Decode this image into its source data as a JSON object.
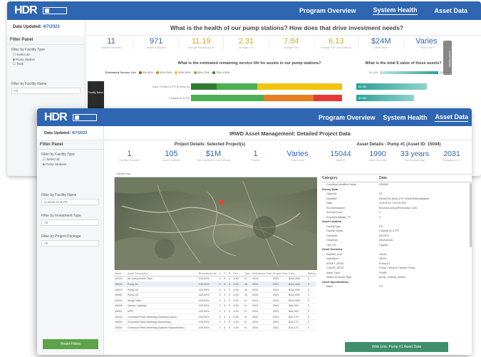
{
  "back": {
    "nav": {
      "program": "Program Overview",
      "health": "System Health",
      "assets": "Asset Data"
    },
    "data_updated_label": "Data Updated:",
    "data_updated_value": "4/7/2023",
    "question": "What is the health of our pump stations? How does that drive investment needs?",
    "filter_panel": {
      "title": "Filter Panel",
      "facility_type_label": "Filter by Facility Type",
      "options": [
        "Select all",
        "Pump Station",
        "Tank"
      ],
      "facility_name_label": "Filter by Facility Name",
      "facility_name_value": "All"
    },
    "kpis": [
      {
        "value": "11",
        "label": "Facilities Reported",
        "color": "#2f66b1"
      },
      {
        "value": "971",
        "label": "Assets Evaluated",
        "color": "#2f66b1"
      },
      {
        "value": "11.19",
        "label": "Average Remaining Life",
        "color": "#e6a21a"
      },
      {
        "value": "2.31",
        "label": "Average CoF",
        "color": "#c9b21c"
      },
      {
        "value": "7.84",
        "label": "Average Risk",
        "color": "#c9b21c"
      },
      {
        "value": "6.13",
        "label": "Average PoF (Yrs to failure)",
        "color": "#c9b21c"
      },
      {
        "value": "$24M",
        "label": "Asset Value",
        "color": "#2f66b1"
      },
      {
        "value": "Varies",
        "label": "Install Year",
        "color": "#2f66b1"
      }
    ],
    "chart_q1": "What is the estimated remaining service life for assets in our pump stations?",
    "chart_q2": "What is the total $ value of these assets?",
    "legend_title": "Estimated Service Life",
    "legend": [
      {
        "label": "0%-10%",
        "color": "#c0392b"
      },
      {
        "label": "10%-25%",
        "color": "#e67e22"
      },
      {
        "label": "25%-50%",
        "color": "#f1c40f"
      },
      {
        "label": "50%-75%",
        "color": "#7cb342"
      },
      {
        "label": "75%-100%",
        "color": "#2e7d32"
      }
    ],
    "value_legend": {
      "min": "$1,429",
      "max": "$1,941"
    },
    "side_tab": "Asset Details",
    "rows": [
      {
        "name": "Lake Forest Dr PS (Forest N)",
        "val": "$2.9M",
        "segs": [
          0.17,
          0.27,
          0.56,
          0,
          0
        ],
        "fill": 0.72
      },
      {
        "name": "Coastal Dr & PS",
        "val": "$2.8M",
        "segs": [
          0,
          0.48,
          0,
          0.33,
          0.19
        ],
        "fill": 0.55
      }
    ],
    "facility_label": "Facility Name"
  },
  "front": {
    "nav": {
      "program": "Program Overview",
      "health": "System Health",
      "assets": "Asset Data"
    },
    "data_updated_label": "Data Updated:",
    "data_updated_value": "4/7/2023",
    "title": "IRWD Asset Management: Detailed Project Data",
    "filter_panel": {
      "title": "Filter Panel",
      "facility_type_label": "Filter by Facility Type",
      "options": [
        "Select all",
        "Pump Stations"
      ],
      "facility_name_label": "Filter by Facility Name",
      "facility_name_value": "Coastal Dr & PS",
      "investment_label": "Filter by Investment Type",
      "investment_value": "All",
      "package_label": "Filter by Project Package",
      "package_value": "All",
      "reset": "Reset Filters"
    },
    "project_header": "Project Details: Selected Project(s)",
    "project_kpis": [
      {
        "value": "1",
        "label": "Facilities Selected"
      },
      {
        "value": "105",
        "label": "Assets Selected"
      },
      {
        "value": "$1M",
        "label": "Total Investment Cost Estimate"
      },
      {
        "value": "1",
        "label": "Projects"
      },
      {
        "value": "Varies",
        "label": "Project Year"
      }
    ],
    "map_label": "Satellite Map",
    "asset_header": "Asset Details - Pump #1 (Asset ID: 15044)",
    "asset_kpis": [
      {
        "value": "15044",
        "label": "Asset ID"
      },
      {
        "value": "1990",
        "label": "Install Year (est)"
      },
      {
        "value": "33 years",
        "label": "Current Asset Age"
      },
      {
        "value": "2031",
        "label": "Replacement Yr"
      }
    ],
    "table_headers": [
      "Asset",
      "Asset Description",
      "Remaining Life",
      "C",
      "P",
      "R",
      "EUL",
      "Type",
      "Investment Year",
      "Project Year",
      "Cost",
      "Rating"
    ],
    "table_rows": [
      [
        "15104",
        "Air Compressor Tank",
        "100.00%",
        "2",
        "3",
        "3",
        "3.00",
        "N",
        "2031",
        "2031",
        "$112,006",
        "3"
      ],
      [
        "15044",
        "Pump #1",
        "100.00%",
        "2",
        "3",
        "3",
        "3.00",
        "10",
        "2031",
        "2031",
        "$112,006",
        "3"
      ],
      [
        "15002",
        "Pump #2",
        "100.00%",
        "2",
        "3",
        "3",
        "3.00",
        "10",
        "2031",
        "2031",
        "$112,006",
        "3"
      ],
      [
        "15060",
        "Pump #3",
        "100.00%",
        "2",
        "3",
        "3",
        "3.00",
        "10",
        "2031",
        "2031",
        "$112,006",
        "3"
      ],
      [
        "15010",
        "Surge Tank",
        "100.00%",
        "2",
        "3",
        "3",
        "3.00",
        "N",
        "2031",
        "2031",
        "$112,006",
        "3"
      ],
      [
        "15006",
        "Interior Lighting",
        "100.00%",
        "2",
        "3",
        "3",
        "3.00",
        "N",
        "2031",
        "2031",
        "$46,000",
        "3"
      ],
      [
        "15041",
        "UPS",
        "100.00%",
        "2",
        "3",
        "3",
        "3.00",
        "N",
        "2031",
        "2031",
        "$46,000",
        "3"
      ],
      [
        "15014",
        "Chemical Feed Metering (Sodium/Liquid)",
        "100.00%",
        "2",
        "3",
        "3",
        "3.00",
        "N",
        "2031",
        "2031",
        "$14,170",
        "3"
      ],
      [
        "15024",
        "Chemical Feed Metering (Ammonia)",
        "100.00%",
        "2",
        "3",
        "3",
        "3.00",
        "N",
        "2031",
        "2031",
        "$14,170",
        "3"
      ],
      [
        "15000",
        "Chemical Feed Metering (Sodium Hypochlorite)",
        "100.00%",
        "2",
        "3",
        "3",
        "3.00",
        "N",
        "2031",
        "2031",
        "$14,170",
        "3"
      ]
    ],
    "details_header": {
      "cat": "Category",
      "data": "Data"
    },
    "details": [
      [
        "",
        "Condition Modified Value",
        "234958"
      ],
      [
        "c",
        "Survey Data",
        ""
      ],
      [
        "",
        "ObjectId",
        "32"
      ],
      [
        "",
        "GlobalID",
        "452a6791-af1a-4747-b1e8-0b6b2a0adefe"
      ],
      [
        "",
        "Date",
        "10/4/2022 7:00:00 PM"
      ],
      [
        "",
        "SurveyInstance",
        "ElectricContractForecasts_v0/8"
      ],
      [
        "",
        "SurveyCount",
        "1"
      ],
      [
        "",
        "SurveyDuplicate_TF",
        "0"
      ],
      [
        "c",
        "Asset Location",
        ""
      ],
      [
        "",
        "FacilityType",
        "PS"
      ],
      [
        "",
        "Facility Name",
        "Coastal Dr & PS"
      ],
      [
        "",
        "FacilityID",
        "2970571"
      ],
      [
        "",
        "Discipline",
        "Mechanical"
      ],
      [
        "",
        "CM_OS",
        "Capital"
      ],
      [
        "c",
        "Asset Overview",
        ""
      ],
      [
        "",
        "AssetID_text",
        "15044"
      ],
      [
        "",
        "AssetNum",
        "15044"
      ],
      [
        "",
        "ASSET_DESC",
        "Pump #1"
      ],
      [
        "",
        "CLASS_DESC",
        "Pump / Vertical Turbine Pump"
      ],
      [
        "",
        "Asset Type",
        "PUMP"
      ],
      [
        "",
        "Select an Asset Type",
        "pump_vertical_turbine"
      ],
      [
        "c",
        "Asset Specifications",
        ""
      ],
      [
        "",
        "Make",
        "ITT"
      ]
    ],
    "web_link": "Web Link: Pump #1 Asset Data"
  }
}
